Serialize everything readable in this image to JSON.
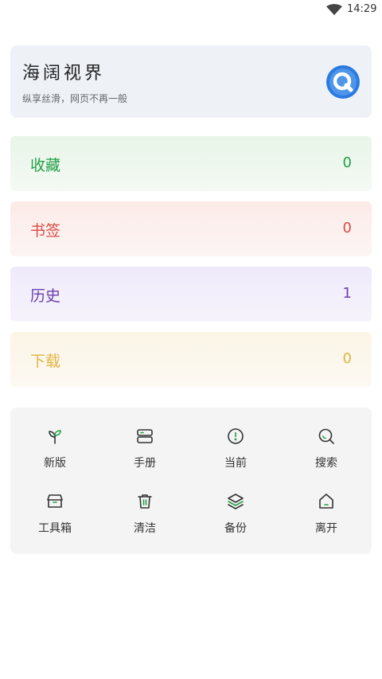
{
  "status_bar": {
    "time": "14:29"
  },
  "header": {
    "title": "海阔视界",
    "subtitle": "纵享丝滑，网页不再一般"
  },
  "rows": [
    {
      "label": "收藏",
      "count": "0",
      "color": "#22a045"
    },
    {
      "label": "书签",
      "count": "0",
      "color": "#d84c44"
    },
    {
      "label": "历史",
      "count": "1",
      "color": "#6b3fb0"
    },
    {
      "label": "下载",
      "count": "0",
      "color": "#e1b442"
    }
  ],
  "tools": [
    {
      "label": "新版",
      "icon": "sprout-icon"
    },
    {
      "label": "手册",
      "icon": "manual-icon"
    },
    {
      "label": "当前",
      "icon": "info-circle-icon"
    },
    {
      "label": "搜索",
      "icon": "search-icon"
    },
    {
      "label": "工具箱",
      "icon": "toolbox-icon"
    },
    {
      "label": "清洁",
      "icon": "trash-icon"
    },
    {
      "label": "备份",
      "icon": "layers-icon"
    },
    {
      "label": "离开",
      "icon": "home-icon"
    }
  ],
  "accent_color": "#2a7ae2"
}
